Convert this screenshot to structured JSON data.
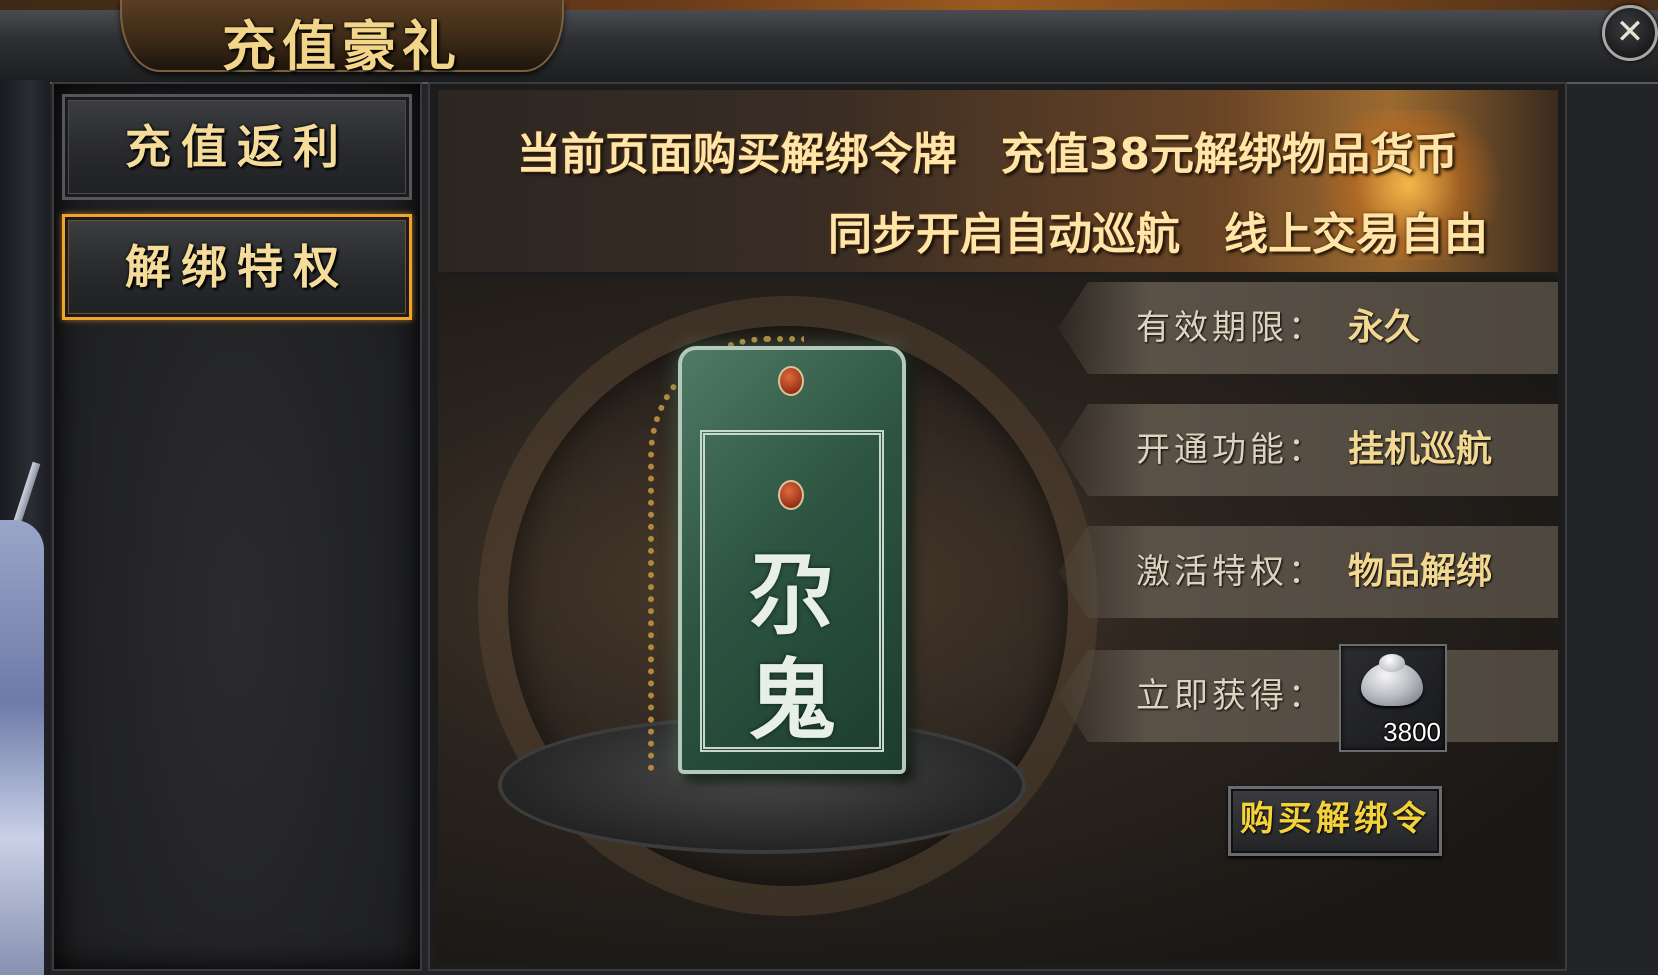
{
  "window": {
    "title": "充值豪礼",
    "close_label": "✕"
  },
  "sidebar": {
    "tabs": [
      {
        "label": "充值返利",
        "active": false
      },
      {
        "label": "解绑特权",
        "active": true
      }
    ]
  },
  "banner": {
    "line1": "当前页面购买解绑令牌　充值38元解绑物品货币",
    "line2": "同步开启自动巡航　线上交易自由"
  },
  "token": {
    "glyph_top": "尕",
    "glyph_bottom": "鬼"
  },
  "details": [
    {
      "label": "有效期限：",
      "value": "永久"
    },
    {
      "label": "开通功能：",
      "value": "挂机巡航"
    },
    {
      "label": "激活特权：",
      "value": "物品解绑"
    },
    {
      "label": "立即获得：",
      "value": ""
    }
  ],
  "reward": {
    "icon": "silver-ingot-icon",
    "count": "3800"
  },
  "buy_button": {
    "label": "购买解绑令"
  },
  "colors": {
    "accent": "#f0a52a",
    "title_gold": "#f3d58a",
    "button_text": "#f6d23a"
  }
}
